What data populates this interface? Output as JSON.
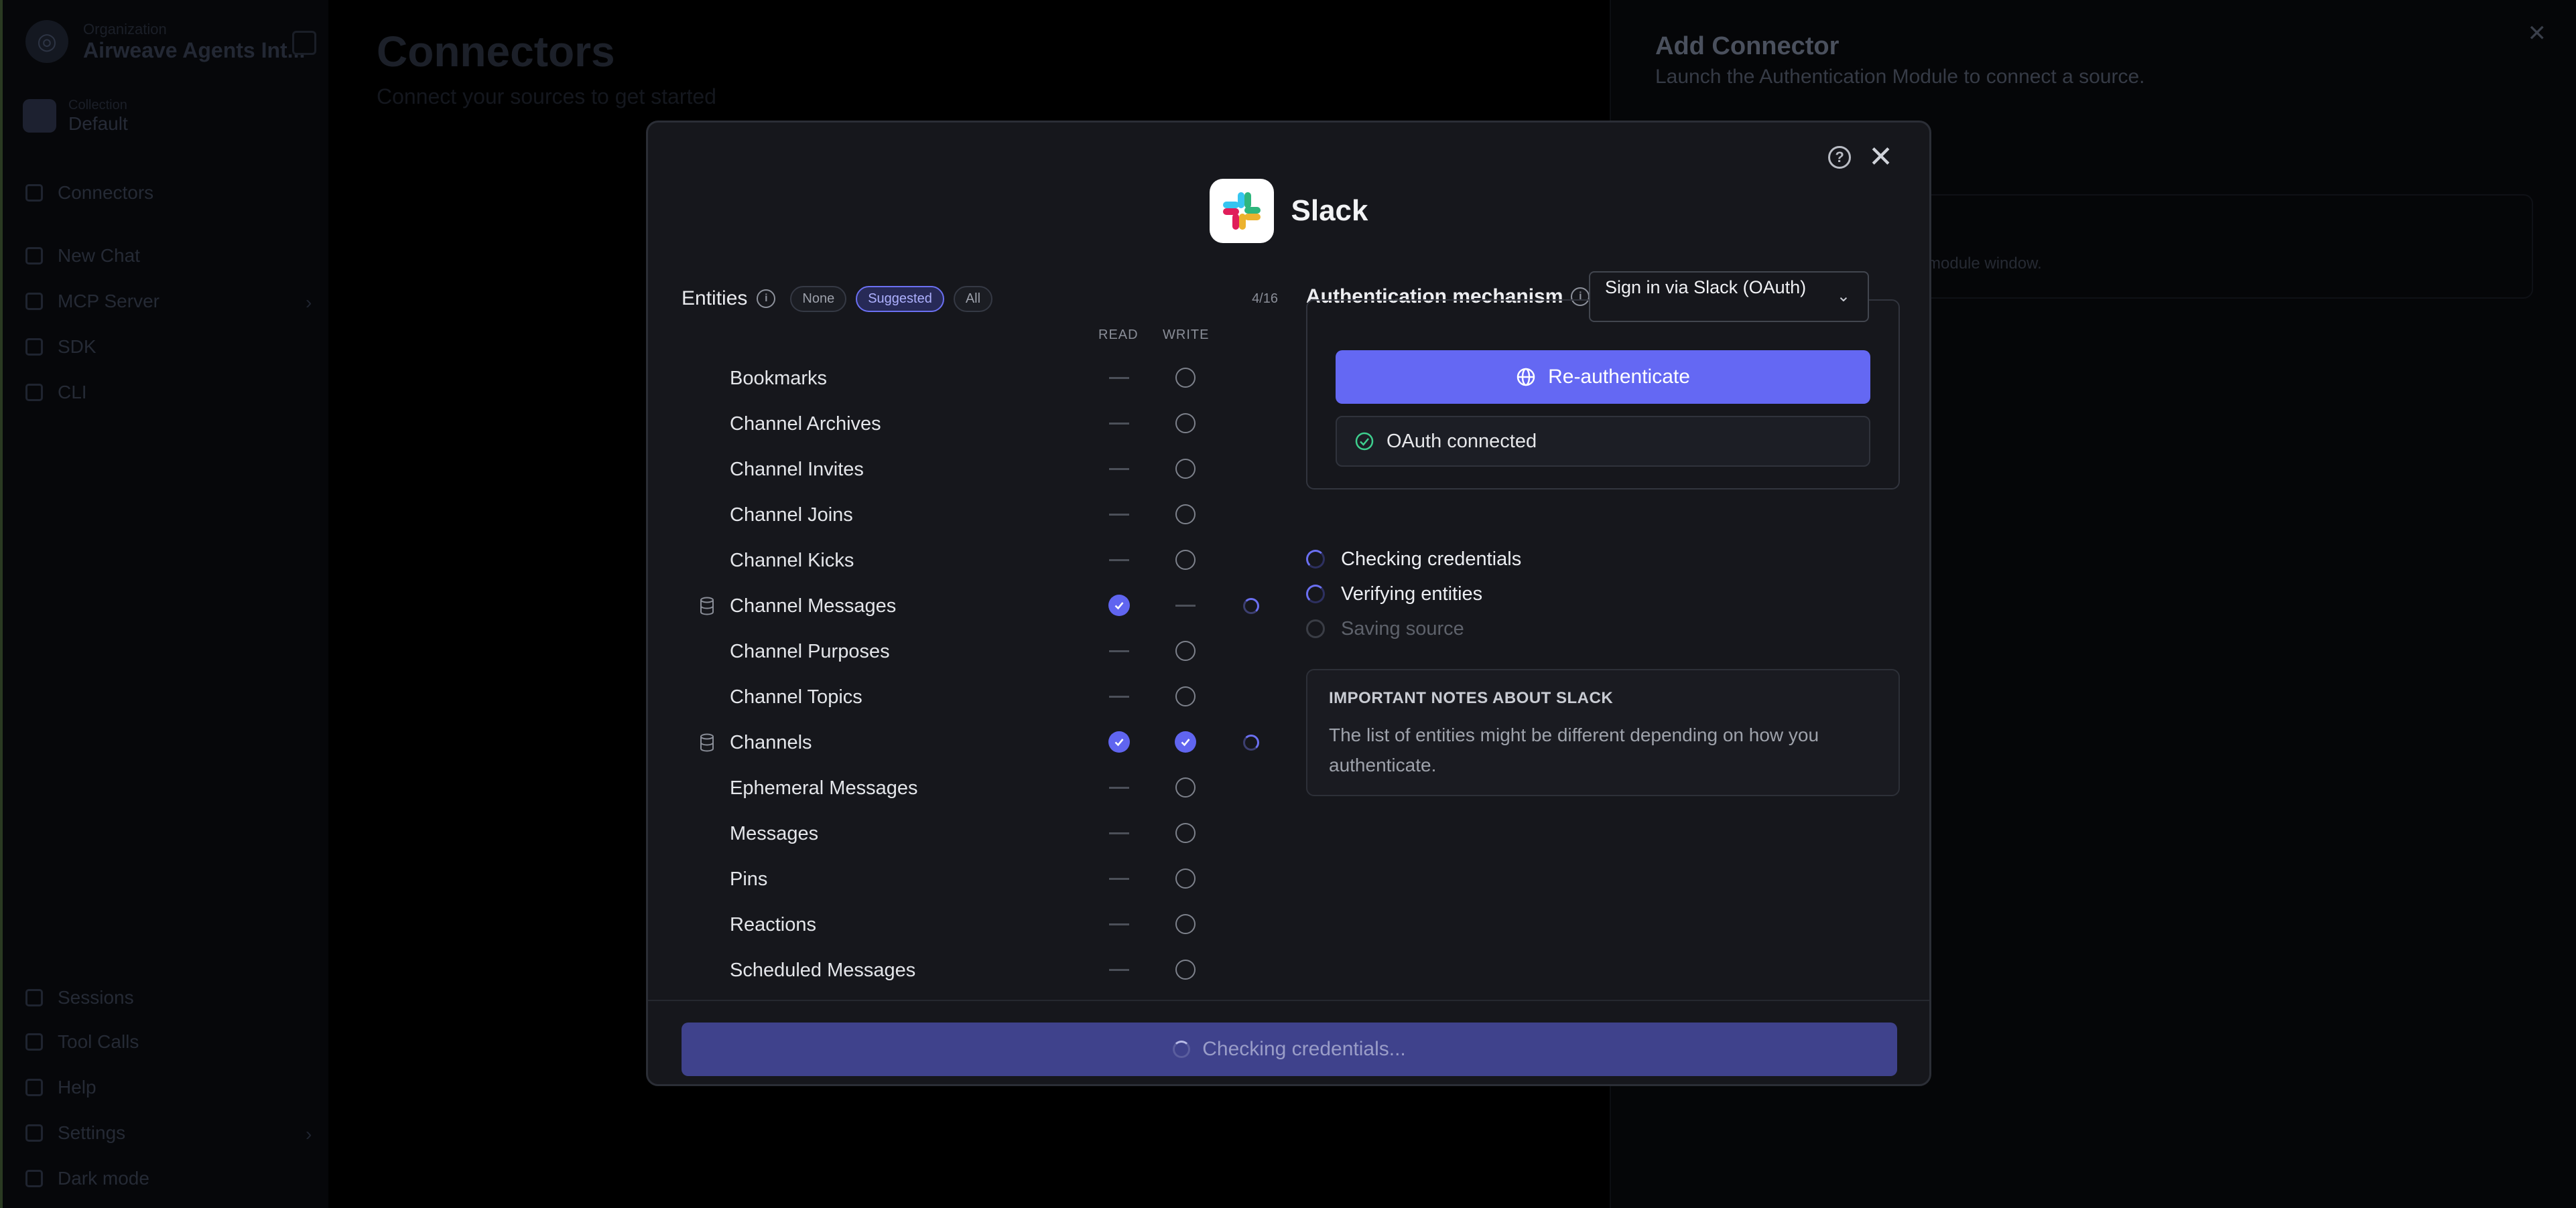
{
  "sidebar": {
    "org_small": "Organization",
    "org_name": "Airweave Agents Int...",
    "project_small": "Collection",
    "project_name": "Default",
    "items": [
      {
        "label": "Connectors"
      },
      {
        "label": "New Chat"
      },
      {
        "label": "MCP Server"
      },
      {
        "label": "SDK"
      },
      {
        "label": "CLI"
      },
      {
        "label": "Sessions"
      },
      {
        "label": "Tool Calls"
      },
      {
        "label": "Help"
      },
      {
        "label": "Settings"
      },
      {
        "label": "Dark mode"
      }
    ]
  },
  "page": {
    "title": "Connectors",
    "subtitle": "Connect your sources to get started"
  },
  "drawer": {
    "title": "Add Connector",
    "subtitle": "Launch the Authentication Module to connect a source.",
    "card_text": "module window."
  },
  "modal": {
    "app_name": "Slack",
    "entities": {
      "title": "Entities",
      "pills": [
        "None",
        "Suggested",
        "All"
      ],
      "count": "4/16",
      "col_read": "READ",
      "col_write": "WRITE",
      "rows": [
        {
          "label": "Bookmarks",
          "read": "none",
          "write": "off"
        },
        {
          "label": "Channel Archives",
          "read": "none",
          "write": "off"
        },
        {
          "label": "Channel Invites",
          "read": "none",
          "write": "off"
        },
        {
          "label": "Channel Joins",
          "read": "none",
          "write": "off"
        },
        {
          "label": "Channel Kicks",
          "read": "none",
          "write": "off"
        },
        {
          "label": "Channel Messages",
          "read": "on",
          "write": "none",
          "db": true,
          "loading": true
        },
        {
          "label": "Channel Purposes",
          "read": "none",
          "write": "off"
        },
        {
          "label": "Channel Topics",
          "read": "none",
          "write": "off"
        },
        {
          "label": "Channels",
          "read": "on",
          "write": "on",
          "db": true,
          "loading": true
        },
        {
          "label": "Ephemeral Messages",
          "read": "none",
          "write": "off"
        },
        {
          "label": "Messages",
          "read": "none",
          "write": "off"
        },
        {
          "label": "Pins",
          "read": "none",
          "write": "off"
        },
        {
          "label": "Reactions",
          "read": "none",
          "write": "off"
        },
        {
          "label": "Scheduled Messages",
          "read": "none",
          "write": "off"
        }
      ]
    },
    "auth": {
      "label": "Authentication mechanism",
      "select_value": "Sign in via Slack (OAuth)",
      "reauth_label": "Re-authenticate",
      "status": "OAuth connected"
    },
    "steps": [
      {
        "label": "Checking credentials",
        "state": "loading"
      },
      {
        "label": "Verifying entities",
        "state": "loading"
      },
      {
        "label": "Saving source",
        "state": "idle"
      }
    ],
    "notes": {
      "title": "IMPORTANT NOTES ABOUT SLACK",
      "body": "The list of entities might be different depending on how you authenticate."
    },
    "cta_label": "Checking credentials..."
  },
  "colors": {
    "accent": "#6468f3",
    "background": "#000000",
    "modal": "#16171c",
    "success": "#3ecf8e"
  }
}
